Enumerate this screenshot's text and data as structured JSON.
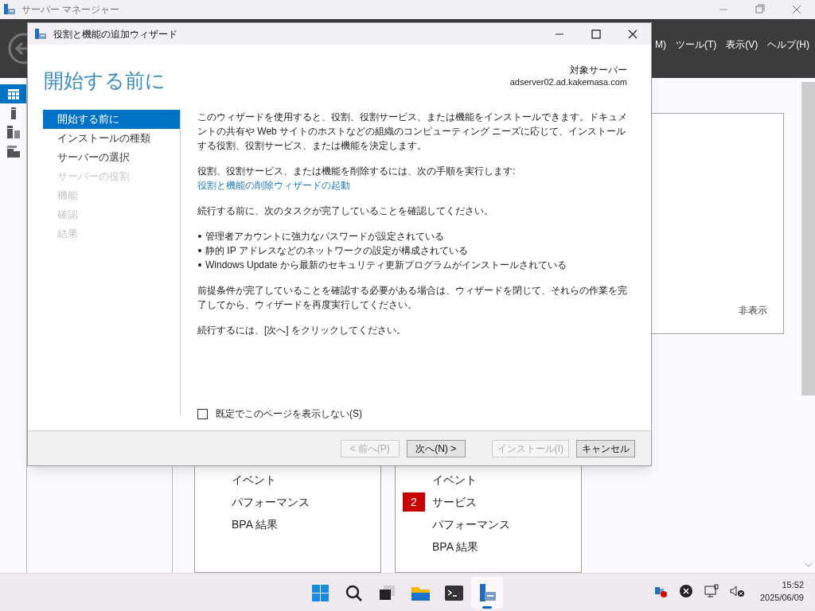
{
  "server_manager": {
    "title": "サーバー マネージャー",
    "menu": [
      "M)",
      "ツール(T)",
      "表示(V)",
      "ヘルプ(H)"
    ],
    "nav_icons": [
      {
        "kind": "dashboard",
        "selected": true
      },
      {
        "kind": "local",
        "selected": false
      },
      {
        "kind": "all",
        "selected": false
      },
      {
        "kind": "file",
        "selected": false
      }
    ],
    "hide_link": "非表示",
    "tiles": [
      {
        "items": [
          {
            "label": "イベント"
          },
          {
            "label": "パフォーマンス"
          },
          {
            "label": "BPA 結果"
          }
        ]
      },
      {
        "items": [
          {
            "label": "イベント"
          },
          {
            "label": "サービス",
            "badge": "2"
          },
          {
            "label": "パフォーマンス"
          },
          {
            "label": "BPA 結果"
          }
        ]
      }
    ]
  },
  "dialog": {
    "title": "役割と機能の追加ウィザード",
    "page_title": "開始する前に",
    "target_label": "対象サーバー",
    "target_server": "adserver02.ad.kakemasa.com",
    "steps": [
      {
        "label": "開始する前に",
        "selected": true,
        "disabled": false
      },
      {
        "label": "インストールの種類",
        "selected": false,
        "disabled": false
      },
      {
        "label": "サーバーの選択",
        "selected": false,
        "disabled": false
      },
      {
        "label": "サーバーの役割",
        "selected": false,
        "disabled": true
      },
      {
        "label": "機能",
        "selected": false,
        "disabled": true
      },
      {
        "label": "確認",
        "selected": false,
        "disabled": true
      },
      {
        "label": "結果",
        "selected": false,
        "disabled": true
      }
    ],
    "content": [
      {
        "kind": "text",
        "text": "このウィザードを使用すると、役割、役割サービス、または機能をインストールできます。ドキュメントの共有や Web サイトのホストなどの組織のコンピューティング ニーズに応じて、インストールする役割、役割サービス、または機能を決定します。"
      },
      {
        "kind": "text",
        "text": "役割、役割サービス、または機能を削除するには、次の手順を実行します:",
        "link": "役割と機能の削除ウィザードの起動"
      },
      {
        "kind": "text",
        "text": "続行する前に、次のタスクが完了していることを確認してください。"
      },
      {
        "kind": "bullets",
        "items": [
          "管理者アカウントに強力なパスワードが設定されている",
          "静的 IP アドレスなどのネットワークの設定が構成されている",
          "Windows Update から最新のセキュリティ更新プログラムがインストールされている"
        ]
      },
      {
        "kind": "text",
        "text": "前提条件が完了していることを確認する必要がある場合は、ウィザードを閉じて、それらの作業を完了してから、ウィザードを再度実行してください。"
      },
      {
        "kind": "text",
        "text": "続行するには、[次へ] をクリックしてください。"
      }
    ],
    "checkbox": {
      "label": "既定でこのページを表示しない(S)",
      "checked": false
    },
    "buttons": [
      {
        "label": "< 前へ(P)",
        "disabled": true
      },
      {
        "label": "次へ(N) >",
        "disabled": false
      },
      {
        "label": "インストール(I)",
        "disabled": true
      },
      {
        "label": "キャンセル",
        "disabled": false
      }
    ]
  },
  "taskbar": {
    "apps": [
      {
        "kind": "start",
        "active": false
      },
      {
        "kind": "search",
        "active": false
      },
      {
        "kind": "taskview",
        "active": false
      },
      {
        "kind": "explorer",
        "active": false
      },
      {
        "kind": "terminal",
        "active": false
      },
      {
        "kind": "servermanager",
        "active": true
      }
    ],
    "time": "15:52",
    "date": "2025/06/09"
  }
}
